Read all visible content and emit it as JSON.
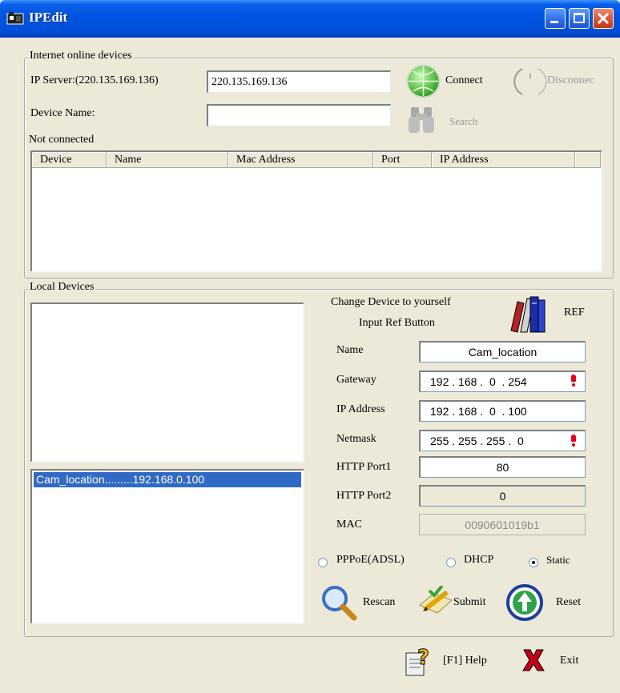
{
  "window": {
    "title": "IPEdit"
  },
  "internet_group": {
    "label": "Internet online devices",
    "ip_server_label": "IP Server:(220.135.169.136)",
    "ip_server_value": "220.135.169.136",
    "connect_label": "Connect",
    "disconnect_label": "Disconnec",
    "device_name_label": "Device Name:",
    "device_name_value": "",
    "search_label": "Search",
    "status_text": "Not connected",
    "columns": [
      "Device",
      "Name",
      "Mac Address",
      "Port",
      "IP Address"
    ]
  },
  "local_group": {
    "label": "Local Devices",
    "device_list": [
      "Cam_location.........192.168.0.100"
    ],
    "ref_line1": "Change Device to yourself",
    "ref_line2": "Input Ref Button",
    "ref_label": "REF",
    "fields": {
      "name_label": "Name",
      "name_value": "Cam_location",
      "gateway_label": "Gateway",
      "gateway_value": "192 . 168 .  0  . 254",
      "ip_label": "IP Address",
      "ip_value": "192 . 168 .  0  . 100",
      "netmask_label": "Netmask",
      "netmask_value": "255 . 255 . 255 .  0",
      "http1_label": "HTTP Port1",
      "http1_value": "80",
      "http2_label": "HTTP Port2",
      "http2_value": "0",
      "mac_label": "MAC",
      "mac_value": "0090601019b1"
    },
    "modes": {
      "pppoe_label": "PPPoE(ADSL)",
      "dhcp_label": "DHCP",
      "static_label": "Static",
      "selected": "Static"
    },
    "rescan_label": "Rescan",
    "submit_label": "Submit",
    "reset_label": "Reset"
  },
  "footer": {
    "help_label": "[F1] Help",
    "exit_label": "Exit"
  },
  "colors": {
    "titlebar": "#0053e1",
    "selection": "#316ac5",
    "window_bg": "#ece9d8",
    "alert_red": "#e0001b"
  },
  "icons": [
    "camera-icon",
    "minimize-icon",
    "maximize-icon",
    "close-icon",
    "globe-connect-icon",
    "disconnect-icon",
    "binoculars-icon",
    "books-icon",
    "magnifier-icon",
    "pencil-check-icon",
    "up-arrow-icon",
    "help-icon",
    "exit-x-icon",
    "alert-icon"
  ]
}
